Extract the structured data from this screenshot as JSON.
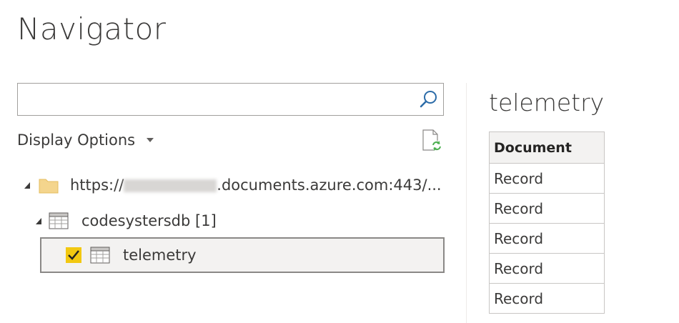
{
  "dialog": {
    "title": "Navigator"
  },
  "search": {
    "value": "",
    "placeholder": ""
  },
  "display_options": {
    "label": "Display Options"
  },
  "tree": {
    "source": {
      "url_prefix": "https://",
      "url_suffix": ".documents.azure.com:443/..."
    },
    "database": {
      "label": "codesystersdb [1]"
    },
    "table": {
      "label": "telemetry",
      "checked": true
    }
  },
  "preview": {
    "title": "telemetry",
    "columns": [
      "Document"
    ],
    "rows": [
      "Record",
      "Record",
      "Record",
      "Record",
      "Record"
    ]
  },
  "colors": {
    "checkbox": "#f2c811",
    "search_icon": "#2b6ba8",
    "refresh_icon": "#4caf50",
    "folder": "#f4d58d"
  }
}
